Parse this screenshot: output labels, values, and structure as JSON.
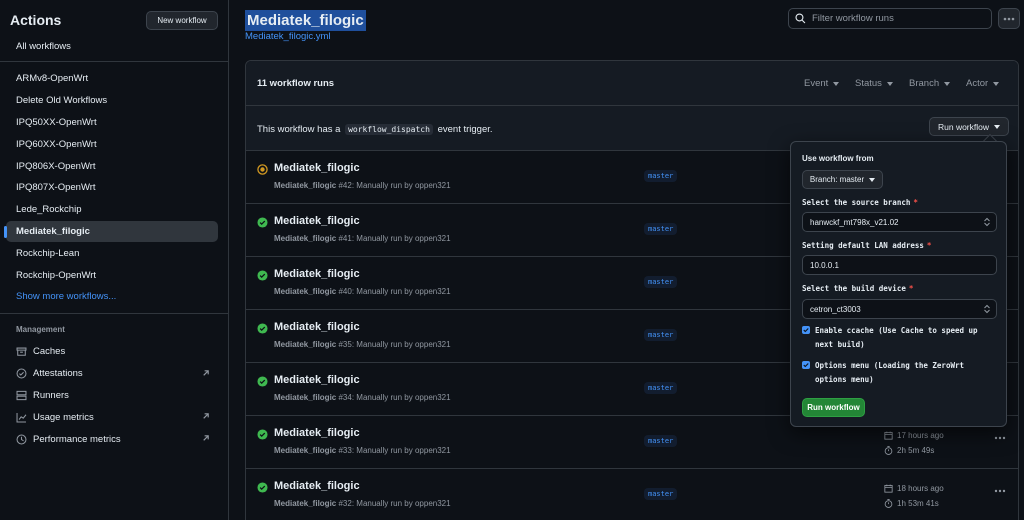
{
  "sidebar": {
    "title": "Actions",
    "new_workflow_label": "New workflow",
    "all_workflows_label": "All workflows",
    "workflows": [
      {
        "label": "ARMv8-OpenWrt"
      },
      {
        "label": "Delete Old Workflows"
      },
      {
        "label": "IPQ50XX-OpenWrt"
      },
      {
        "label": "IPQ60XX-OpenWrt"
      },
      {
        "label": "IPQ806X-OpenWrt"
      },
      {
        "label": "IPQ807X-OpenWrt"
      },
      {
        "label": "Lede_Rockchip"
      },
      {
        "label": "Mediatek_filogic"
      },
      {
        "label": "Rockchip-Lean"
      },
      {
        "label": "Rockchip-OpenWrt"
      }
    ],
    "active_workflow": "Mediatek_filogic",
    "show_more_label": "Show more workflows...",
    "management_title": "Management",
    "management": [
      {
        "label": "Caches",
        "icon": "archive-icon"
      },
      {
        "label": "Attestations",
        "icon": "verified-icon"
      },
      {
        "label": "Runners",
        "icon": "server-icon"
      },
      {
        "label": "Usage metrics",
        "icon": "graph-icon"
      },
      {
        "label": "Performance metrics",
        "icon": "pulse-icon"
      }
    ]
  },
  "header": {
    "title": "Mediatek_filogic",
    "subtitle": "Mediatek_filogic.yml",
    "filter_placeholder": "Filter workflow runs"
  },
  "runs": {
    "count_label": "11 workflow runs",
    "filters": [
      "Event",
      "Status",
      "Branch",
      "Actor"
    ],
    "dispatch_prefix": "This workflow has a",
    "dispatch_code": "workflow_dispatch",
    "dispatch_suffix": "event trigger.",
    "run_workflow_label": "Run workflow",
    "items": [
      {
        "status": "in-progress",
        "title": "Mediatek_filogic",
        "workflow": "Mediatek_filogic",
        "meta": "#42: Manually run by oppen321",
        "branch": "master"
      },
      {
        "status": "success",
        "title": "Mediatek_filogic",
        "workflow": "Mediatek_filogic",
        "meta": "#41: Manually run by oppen321",
        "branch": "master"
      },
      {
        "status": "success",
        "title": "Mediatek_filogic",
        "workflow": "Mediatek_filogic",
        "meta": "#40: Manually run by oppen321",
        "branch": "master"
      },
      {
        "status": "success",
        "title": "Mediatek_filogic",
        "workflow": "Mediatek_filogic",
        "meta": "#35: Manually run by oppen321",
        "branch": "master"
      },
      {
        "status": "success",
        "title": "Mediatek_filogic",
        "workflow": "Mediatek_filogic",
        "meta": "#34: Manually run by oppen321",
        "branch": "master"
      },
      {
        "status": "success",
        "title": "Mediatek_filogic",
        "workflow": "Mediatek_filogic",
        "meta": "#33: Manually run by oppen321",
        "branch": "master",
        "time_ago": "17 hours ago",
        "duration": "2h 5m 49s"
      },
      {
        "status": "success",
        "title": "Mediatek_filogic",
        "workflow": "Mediatek_filogic",
        "meta": "#32: Manually run by oppen321",
        "branch": "master",
        "time_ago": "18 hours ago",
        "duration": "1h 53m 41s"
      }
    ]
  },
  "dropdown": {
    "use_from_label": "Use workflow from",
    "branch_button": "Branch: master",
    "source_branch_label": "Select the source branch",
    "source_branch_value": "hanwckf_mt798x_v21.02",
    "lan_label": "Setting default LAN address",
    "lan_value": "10.0.0.1",
    "device_label": "Select the build device",
    "device_value": "cetron_ct3003",
    "required_mark": "*",
    "ccache_label": "Enable ccache (Use Cache to speed up next build)",
    "ccache_checked": true,
    "options_label": "Options menu (Loading the ZeroWrt options menu)",
    "options_checked": true,
    "run_button": "Run workflow"
  },
  "colors": {
    "background": "#0d1117",
    "accent_blue": "#4493f8",
    "success_green": "#3fb950",
    "in_progress_yellow": "#d29922",
    "run_button_green": "#238636"
  }
}
